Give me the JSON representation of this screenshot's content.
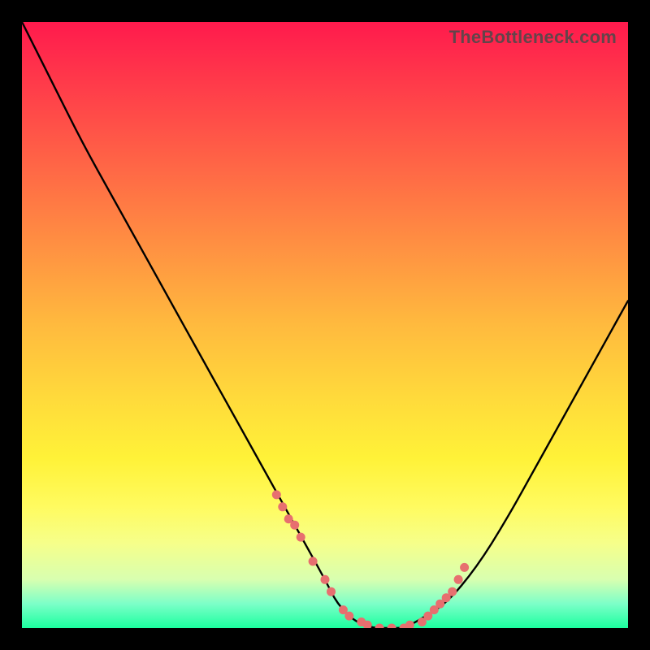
{
  "watermark": "TheBottleneck.com",
  "chart_data": {
    "type": "line",
    "title": "",
    "xlabel": "",
    "ylabel": "",
    "xlim": [
      0,
      100
    ],
    "ylim": [
      0,
      100
    ],
    "legend": false,
    "grid": false,
    "series": [
      {
        "name": "bottleneck-curve",
        "x": [
          0,
          5,
          10,
          15,
          20,
          25,
          30,
          35,
          40,
          45,
          50,
          52,
          55,
          58,
          60,
          63,
          65,
          70,
          75,
          80,
          85,
          90,
          95,
          100
        ],
        "y": [
          100,
          90,
          80,
          71,
          62,
          53,
          44,
          35,
          26,
          17,
          8,
          4,
          1,
          0,
          0,
          0,
          1,
          4,
          10,
          18,
          27,
          36,
          45,
          54
        ]
      }
    ],
    "markers": {
      "name": "highlight-dots",
      "color": "#e76f6f",
      "x": [
        42,
        43,
        44,
        45,
        46,
        48,
        50,
        51,
        53,
        54,
        56,
        57,
        59,
        61,
        63,
        64,
        66,
        67,
        68,
        69,
        70,
        71,
        72,
        73
      ],
      "y": [
        22,
        20,
        18,
        17,
        15,
        11,
        8,
        6,
        3,
        2,
        1,
        0.5,
        0,
        0,
        0,
        0.5,
        1,
        2,
        3,
        4,
        5,
        6,
        8,
        10
      ]
    }
  }
}
